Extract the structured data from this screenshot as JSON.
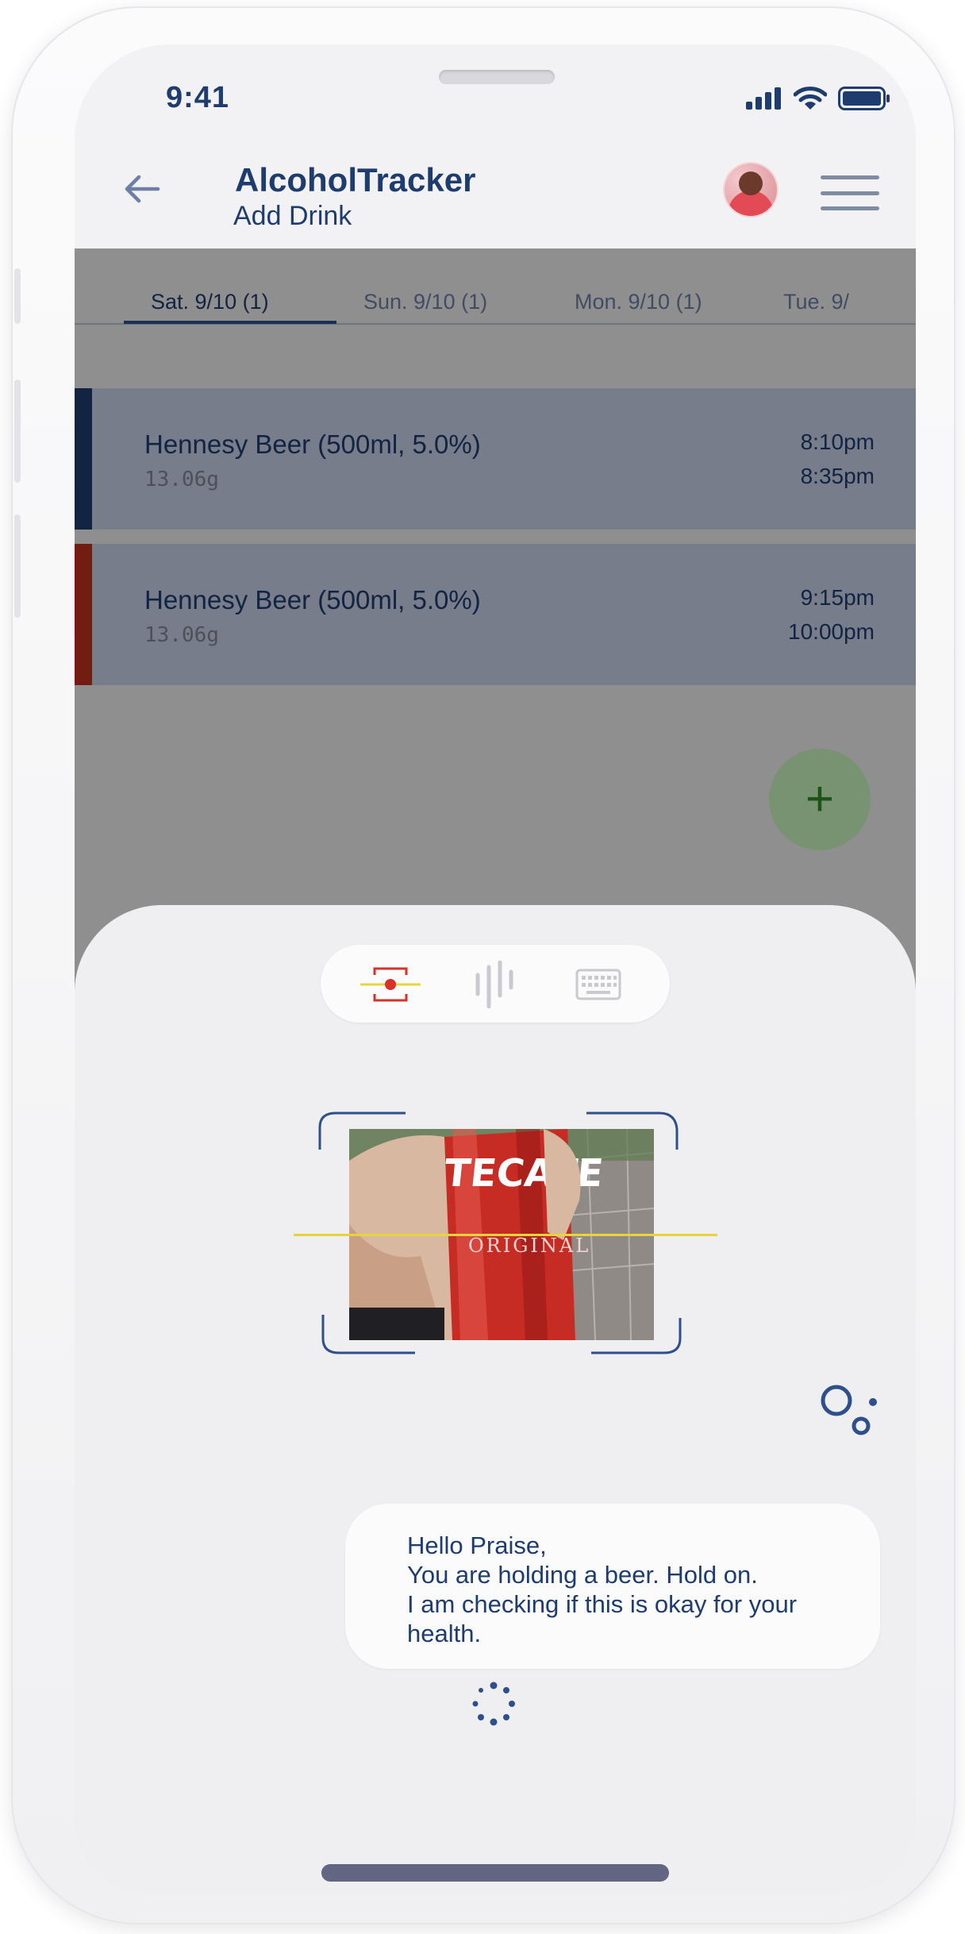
{
  "status": {
    "time": "9:41"
  },
  "header": {
    "title": "AlcoholTracker",
    "subtitle": "Add Drink"
  },
  "tabs": [
    {
      "label": "Sat. 9/10 (1)",
      "active": true
    },
    {
      "label": "Sun. 9/10 (1)",
      "active": false
    },
    {
      "label": "Mon. 9/10 (1)",
      "active": false
    },
    {
      "label": "Tue. 9/",
      "active": false
    }
  ],
  "drinks": [
    {
      "name": "Hennesy Beer (500ml, 5.0%)",
      "grams": "13.06g",
      "start": "8:10pm",
      "end": "8:35pm",
      "accent": "#1f3c6e"
    },
    {
      "name": "Hennesy Beer (500ml, 5.0%)",
      "grams": "13.06g",
      "start": "9:15pm",
      "end": "10:00pm",
      "accent": "#c0301d"
    }
  ],
  "fab": {
    "label": "+"
  },
  "input_modes": [
    {
      "icon": "scan-icon",
      "active": true
    },
    {
      "icon": "voice-icon",
      "active": false
    },
    {
      "icon": "keyboard-icon",
      "active": false
    }
  ],
  "scan_image": {
    "can_text_1": "TECATE",
    "can_text_2": "ORIGINAL"
  },
  "assistant": {
    "message_line_1": "Hello Praise,",
    "message_line_2": "You are holding a beer. Hold on.",
    "message_line_3": "I am checking if this is okay for your health."
  },
  "colors": {
    "primary": "#1f3c6e",
    "fab": "#c8f5bf",
    "scan_line": "#e6d43a",
    "record": "#d9302a"
  }
}
